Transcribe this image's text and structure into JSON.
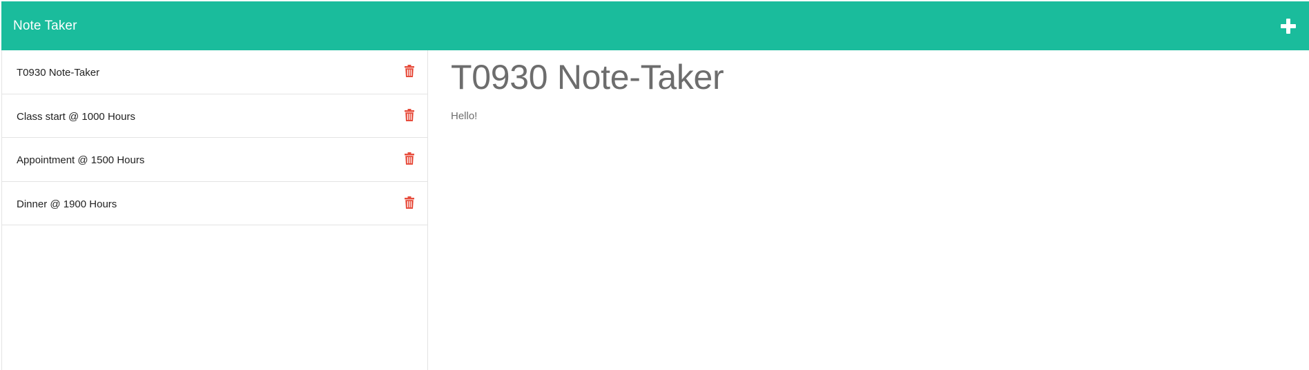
{
  "header": {
    "title": "Note Taker",
    "new_note_icon": "plus-icon"
  },
  "colors": {
    "brand": "#1abc9c",
    "delete": "#e74c3c",
    "text_muted": "#6d6d6d"
  },
  "sidebar": {
    "notes": [
      {
        "title": "T0930 Note-Taker",
        "icon": "trash-icon"
      },
      {
        "title": "Class start @ 1000 Hours",
        "icon": "trash-icon"
      },
      {
        "title": "Appointment @ 1500 Hours",
        "icon": "trash-icon"
      },
      {
        "title": "Dinner @ 1900 Hours",
        "icon": "trash-icon"
      }
    ]
  },
  "main": {
    "note_title": "T0930 Note-Taker",
    "note_text": "Hello!"
  }
}
